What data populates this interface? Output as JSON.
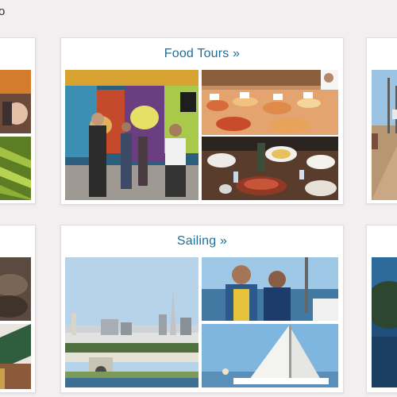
{
  "page": {
    "corner_text": "o"
  },
  "tours": [
    {
      "title": "Food Tours »",
      "photos": [
        "mural-street-tour-photo",
        "seafood-market-stall-photo",
        "shared-dinner-table-photo"
      ]
    },
    {
      "title": "Sailing »",
      "photos": [
        "san-francisco-skyline-photo",
        "couple-on-boat-photo",
        "sailboat-white-sails-photo"
      ]
    }
  ],
  "colors": {
    "title_link": "#1f6f95",
    "page_bg": "#f3eff0",
    "card_bg": "#ffffff"
  }
}
